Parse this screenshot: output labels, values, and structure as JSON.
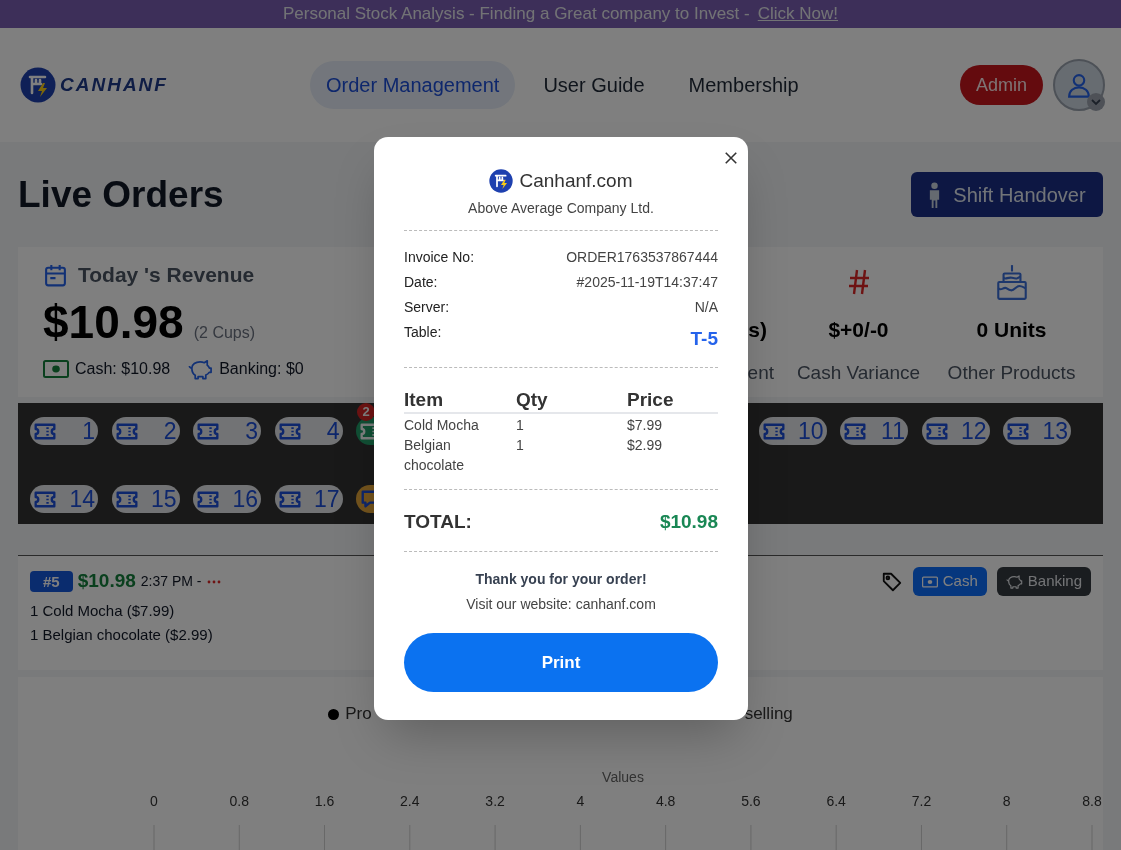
{
  "promo_banner": {
    "text": "Personal Stock Analysis - Finding a Great company to Invest -",
    "link": "Click Now!"
  },
  "header": {
    "logo_text": "CANHANF",
    "nav": [
      {
        "label": "Order Management",
        "selected": true
      },
      {
        "label": "User Guide",
        "selected": false
      },
      {
        "label": "Membership",
        "selected": false
      }
    ],
    "role_button": "Admin"
  },
  "page": {
    "title": "Live Orders",
    "handover_button": "Shift Handover"
  },
  "stats": {
    "revenue": {
      "title": "Today 's Revenue",
      "amount": "$10.98",
      "cups": "(2 Cups)",
      "cash": "Cash: $10.98",
      "banking": "Banking: $0"
    },
    "metrics": [
      {
        "kind": "cut",
        "value": "s)",
        "label": "ent"
      },
      {
        "kind": "full",
        "value": "$+0/-0",
        "label": "Cash Variance"
      },
      {
        "kind": "full",
        "value": "0 Units",
        "label": "Other Products"
      }
    ]
  },
  "tables": {
    "rows": [
      {
        "left": [
          {
            "label": "1",
            "kind": "free"
          },
          {
            "label": "2",
            "kind": "free"
          },
          {
            "label": "3",
            "kind": "free"
          },
          {
            "label": "4",
            "kind": "free"
          },
          {
            "kind": "occupied",
            "badge": "2"
          }
        ],
        "right": [
          {
            "label": "10",
            "kind": "free"
          },
          {
            "label": "11",
            "kind": "free"
          },
          {
            "label": "12",
            "kind": "free"
          },
          {
            "label": "13",
            "kind": "free"
          }
        ]
      },
      {
        "left": [
          {
            "label": "14",
            "kind": "free"
          },
          {
            "label": "15",
            "kind": "free"
          },
          {
            "label": "16",
            "kind": "free"
          },
          {
            "label": "17",
            "kind": "free"
          },
          {
            "kind": "pending"
          }
        ]
      }
    ]
  },
  "order": {
    "number": "#5",
    "total": "$10.98",
    "time": "2:37 PM -",
    "items": [
      "1 Cold Mocha ($7.99)",
      "1 Belgian chocolate ($2.99)"
    ],
    "payments": [
      {
        "label": "Cash",
        "selected": true
      },
      {
        "label": "Banking",
        "selected": false
      }
    ]
  },
  "chart": {
    "legend_texts": [
      "Pro",
      "selling"
    ],
    "axis_title": "Values",
    "tick_labels": [
      "0",
      "0.8",
      "1.6",
      "2.4",
      "3.2",
      "4",
      "4.8",
      "5.6",
      "6.4",
      "7.2",
      "8",
      "8.8"
    ]
  },
  "receipt": {
    "brand": "Canhanf.com",
    "company": "Above Average Company Ltd.",
    "info": [
      {
        "label": "Invoice No:",
        "value": "ORDER1763537867444",
        "kind": "plain"
      },
      {
        "label": "Date:",
        "value": "#2025-11-19T14:37:47",
        "kind": "plain"
      },
      {
        "label": "Server:",
        "value": "N/A",
        "kind": "plain"
      },
      {
        "label": "Table:",
        "value": "T-5",
        "kind": "highlight"
      }
    ],
    "columns": [
      "Item",
      "Qty",
      "Price"
    ],
    "rows": [
      [
        "Cold Mocha",
        "1",
        "$7.99"
      ],
      [
        "Belgian chocolate",
        "1",
        "$2.99"
      ]
    ],
    "total_label": "TOTAL:",
    "total": "$10.98",
    "thanks": "Thank you for your order!",
    "website": "Visit our website: canhanf.com",
    "print_button": "Print"
  }
}
